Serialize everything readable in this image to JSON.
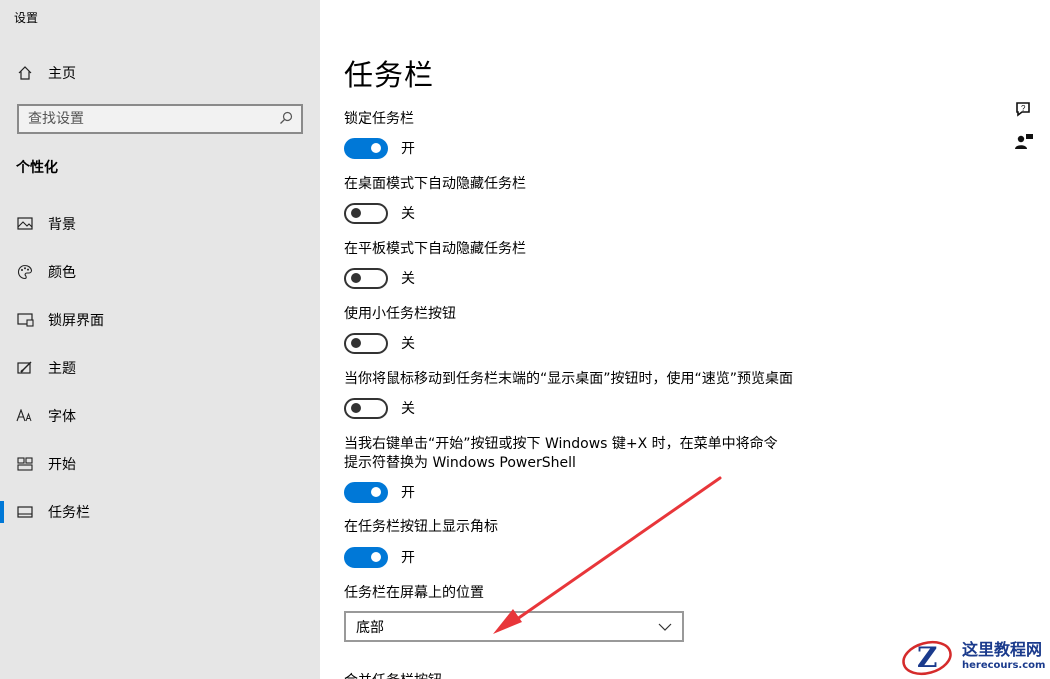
{
  "app": {
    "title": "设置"
  },
  "sidebar": {
    "home_label": "主页",
    "search_placeholder": "查找设置",
    "section": "个性化",
    "items": [
      {
        "label": "背景",
        "icon": "picture-icon"
      },
      {
        "label": "颜色",
        "icon": "palette-icon"
      },
      {
        "label": "锁屏界面",
        "icon": "lockscreen-icon"
      },
      {
        "label": "主题",
        "icon": "theme-icon"
      },
      {
        "label": "字体",
        "icon": "font-icon"
      },
      {
        "label": "开始",
        "icon": "start-icon"
      },
      {
        "label": "任务栏",
        "icon": "taskbar-icon",
        "active": true
      }
    ]
  },
  "main": {
    "title": "任务栏",
    "settings": [
      {
        "label": "锁定任务栏",
        "state": "开",
        "on": true
      },
      {
        "label": "在桌面模式下自动隐藏任务栏",
        "state": "关",
        "on": false
      },
      {
        "label": "在平板模式下自动隐藏任务栏",
        "state": "关",
        "on": false
      },
      {
        "label": "使用小任务栏按钮",
        "state": "关",
        "on": false
      },
      {
        "label": "当你将鼠标移动到任务栏末端的“显示桌面”按钮时，使用“速览”预览桌面",
        "state": "关",
        "on": false
      },
      {
        "label": "当我右键单击“开始”按钮或按下 Windows 键+X 时，在菜单中将命令提示符替换为 Windows PowerShell",
        "state": "开",
        "on": true
      },
      {
        "label": "在任务栏按钮上显示角标",
        "state": "开",
        "on": true
      }
    ],
    "position_label": "任务栏在屏幕上的位置",
    "position_value": "底部",
    "next_label": "合并任务栏按钮"
  },
  "watermark": {
    "cn": "这里教程网",
    "en": "herecours.com"
  },
  "colors": {
    "accent": "#0078d7",
    "sidebar_bg": "#e6e6e6",
    "arrow": "#e8363a"
  }
}
